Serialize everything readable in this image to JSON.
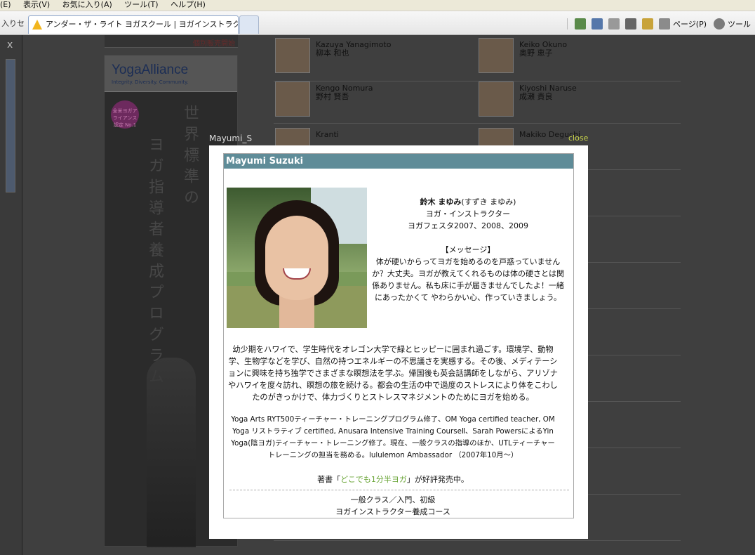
{
  "menubar": {
    "items": [
      "(E)",
      "表示(V)",
      "お気に入り(A)",
      "ツール(T)",
      "ヘルプ(H)"
    ]
  },
  "tabs": {
    "prev_label": "入りセ..",
    "active_label": "アンダー・ザ・ライト ヨガスクール | ヨガインストラクター"
  },
  "toolbar": {
    "page_label": "ページ(P)",
    "tools_label": "ツール"
  },
  "left_pane": {
    "close_label": "x"
  },
  "banner": {
    "top_text": "個別販売開始"
  },
  "yoga_alliance": {
    "logo": "YogaAlliance",
    "tagline": "Integrity. Diversity. Community.",
    "badge": "全米ヨガアライアンス認定 No.1",
    "vertical_1": "世界標準の",
    "vertical_2": "ヨガ指導者養成プログラム"
  },
  "instructors": [
    {
      "en": "Kazuya Yanagimoto",
      "ja": "柳本 和也"
    },
    {
      "en": "Keiko Okuno",
      "ja": "奥野 恵子"
    },
    {
      "en": "Kengo Nomura",
      "ja": "野村 賢吾"
    },
    {
      "en": "Kiyoshi Naruse",
      "ja": "成瀬 貴良"
    },
    {
      "en": "Kranti",
      "ja": ""
    },
    {
      "en": "Makiko Deguchi",
      "ja": ""
    }
  ],
  "lightbox": {
    "caption": "Mayumi_S",
    "close_label": "close",
    "header": "Mayumi Suzuki",
    "name_ja": "鈴木 まゆみ",
    "name_kana": "(すずき まゆみ)",
    "role": "ヨガ・インストラクター",
    "festival": "ヨガフェスタ2007、2008、2009",
    "message_title": "【メッセージ】",
    "message": "体が硬いからってヨガを始めるのを戸惑っていませんか？大丈夫。ヨガが教えてくれるものは体の硬さとは関係ありません。私も床に手が届きませんでしたよ！一緒にあったかくて やわらかい心、作っていきましょう。",
    "bio": "幼少期をハワイで、学生時代をオレゴン大学で緑とヒッピーに囲まれ過ごす。環境学、動物学、生物学などを学び、自然の持つエネルギーの不思議さを実感する。その後、メディテーションに興味を持ち独学でさまざまな瞑想法を学ぶ。帰国後も英会話講師をしながら、アリゾナやハワイを度々訪れ、瞑想の旅を続ける。都会の生活の中で過度のストレスにより体をこわしたのがきっかけで、体力づくりとストレスマネジメントのためにヨガを始める。",
    "cert": "Yoga Arts RYT500ティーチャー・トレーニングプログラム修了、OM Yoga certified teacher, OM Yoga リストラティブ certified, Anusara Intensive Training CourseⅡ、Sarah PowersによるYin Yoga(陰ヨガ)ティーチャー・トレーニング修了。現在、一般クラスの指導のほか、UTLティーチャートレーニングの担当を務める。lululemon Ambassador （2007年10月〜）",
    "book_prefix": "著書「",
    "book_title": "どこでも1分半ヨガ",
    "book_suffix": "」が好評発売中。",
    "class_1": "一般クラス／入門、初級",
    "class_2": "ヨガインストラクター養成コース"
  }
}
